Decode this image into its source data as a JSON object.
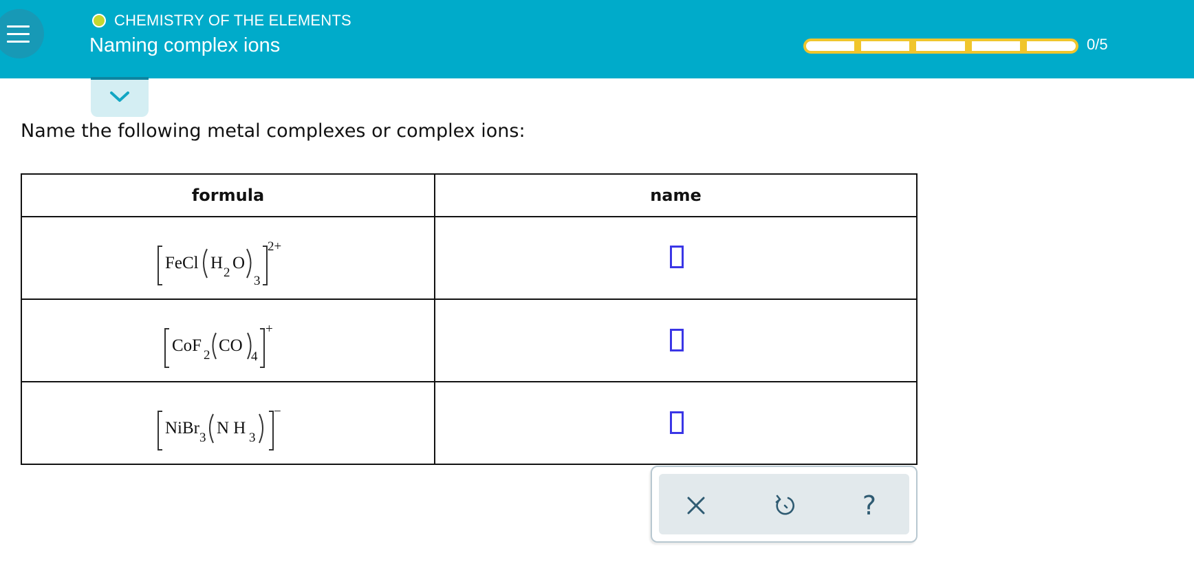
{
  "header": {
    "topic": "CHEMISTRY OF THE ELEMENTS",
    "lesson_title": "Naming complex ions",
    "progress_text": "0/5",
    "progress": {
      "completed": 0,
      "total": 5
    },
    "menu_icon": "hamburger-menu-icon",
    "collapse_icon": "chevron-down-icon"
  },
  "question": {
    "prompt": "Name the following metal complexes or complex ions:"
  },
  "table": {
    "headers": {
      "formula": "formula",
      "name": "name"
    },
    "rows": [
      {
        "formula_text": "[FeCl(H2O)3]2+",
        "parts": {
          "metal": "FeCl",
          "ligand": "H",
          "sub1": "2",
          "ligand_end": "O",
          "count": "3",
          "charge": "2+"
        },
        "name_value": ""
      },
      {
        "formula_text": "[CoF2(CO)4]+",
        "parts": {
          "metal": "CoF",
          "sub0": "2",
          "ligand": "CO",
          "count": "4",
          "charge": "+"
        },
        "name_value": ""
      },
      {
        "formula_text": "[NiBr3(NH3)]−",
        "parts": {
          "metal": "NiBr",
          "sub0": "3",
          "ligand": "N H",
          "sub1": "3",
          "charge": "−"
        },
        "name_value": ""
      }
    ]
  },
  "toolbar": {
    "clear_icon": "x-icon",
    "undo_icon": "undo-icon",
    "help_icon": "question-mark-icon",
    "help_label": "?"
  },
  "colors": {
    "header_bg": "#00abca",
    "progress_accent": "#f0c52c",
    "topic_dot": "#c4d730",
    "answer_box_border": "#3a36e6",
    "toolbar_icon": "#2f5b72"
  }
}
